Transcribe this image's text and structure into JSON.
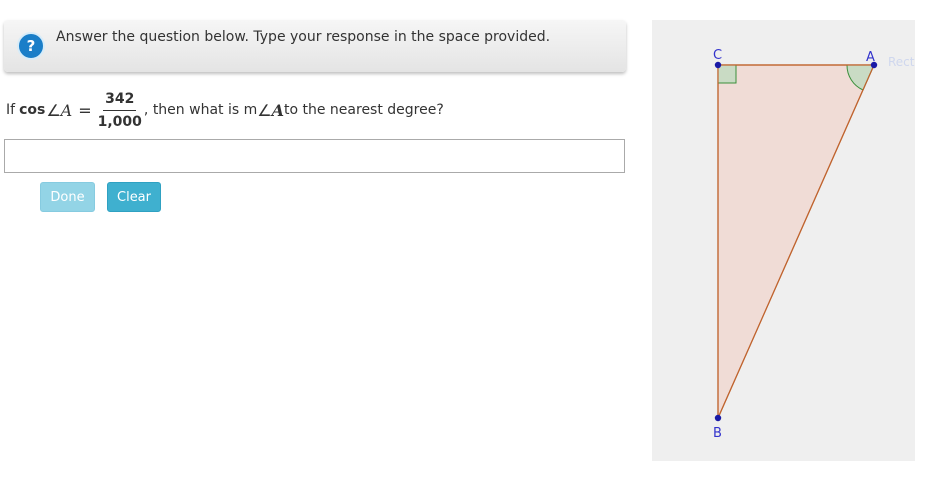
{
  "header": {
    "help_icon": "question-mark-icon",
    "help_glyph": "?",
    "instructions": "Answer the question below. Type your response in the space provided."
  },
  "question": {
    "prefix": "If",
    "function": "cos",
    "angle_symbol": "∠",
    "variable": "A",
    "equals": "=",
    "numerator": "342",
    "denominator": "1,000",
    "middle": ", then what is m",
    "suffix": "to the nearest degree?"
  },
  "answer": {
    "value": "",
    "placeholder": ""
  },
  "buttons": {
    "done_label": "Done",
    "clear_label": "Clear"
  },
  "graph": {
    "points": {
      "c": "C",
      "a": "A",
      "b": "B"
    },
    "ghost_label": "Rectangular",
    "colors": {
      "panel": "#efefef",
      "fill": "#f0dcd6",
      "edge": "#c0642f",
      "point": "#1a1aa6",
      "label": "#3333cc",
      "right_angle_fill": "#c9dbc4",
      "right_angle_stroke": "#3a8f3a"
    }
  }
}
